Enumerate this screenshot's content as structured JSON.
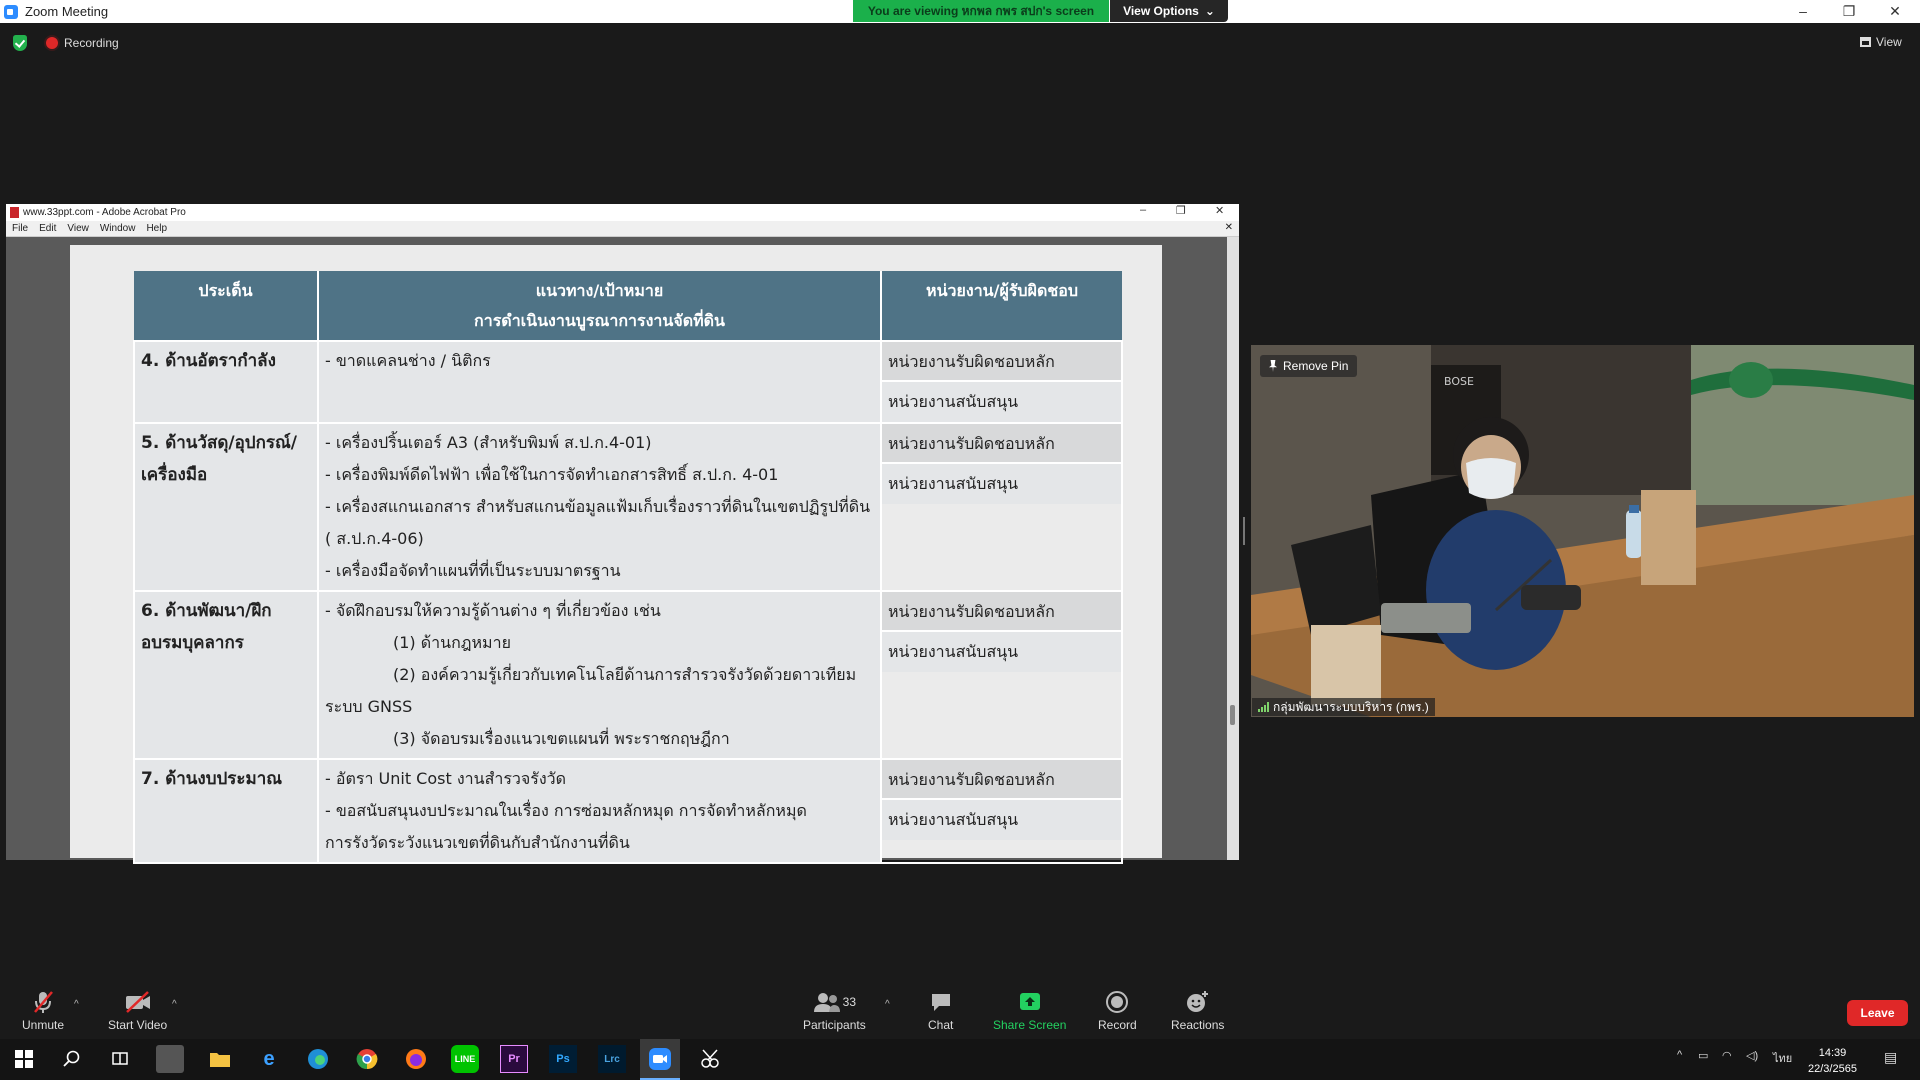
{
  "window": {
    "title": "Zoom Meeting",
    "banner": "You are viewing หกพล กพร สปก's screen",
    "view_options": "View Options",
    "minimize": "–",
    "restore": "❐",
    "close": "✕"
  },
  "meeting_bar": {
    "recording": "Recording",
    "view": "View"
  },
  "acrobat": {
    "title": "www.33ppt.com - Adobe Acrobat Pro",
    "menu": [
      "File",
      "Edit",
      "View",
      "Window",
      "Help"
    ]
  },
  "slide_table": {
    "headers": {
      "issue": "ประเด็น",
      "guide_line1": "แนวทาง/เป้าหมาย",
      "guide_line2": "การดำเนินงานบูรณาการงานจัดที่ดิน",
      "unit": "หน่วยงาน/ผู้รับผิดชอบ"
    },
    "unit_main": "หน่วยงานรับผิดชอบหลัก",
    "unit_support": "หน่วยงานสนับสนุน",
    "rows": [
      {
        "issue": "4. ด้านอัตรากำลัง",
        "lines": [
          "- ขาดแคลนช่าง / นิติกร"
        ]
      },
      {
        "issue": "5. ด้านวัสดุ/อุปกรณ์/เครื่องมือ",
        "lines": [
          "- เครื่องปริ้นเตอร์ A3 (สำหรับพิมพ์ ส.ป.ก.4-01)",
          "- เครื่องพิมพ์ดีดไฟฟ้า เพื่อใช้ในการจัดทำเอกสารสิทธิ์ ส.ป.ก. 4-01",
          "- เครื่องสแกนเอกสาร สำหรับสแกนข้อมูลแฟ้มเก็บเรื่องราวที่ดินในเขตปฏิรูปที่ดิน ( ส.ป.ก.4-06)",
          "- เครื่องมือจัดทำแผนที่ที่เป็นระบบมาตรฐาน"
        ]
      },
      {
        "issue": "6. ด้านพัฒนา/ฝึกอบรมบุคลากร",
        "lines": [
          "- จัดฝึกอบรมให้ความรู้ด้านต่าง ๆ ที่เกี่ยวข้อง เช่น",
          "(1) ด้านกฎหมาย",
          "(2) องค์ความรู้เกี่ยวกับเทคโนโลยีด้านการสำรวจรังวัดด้วยดาวเทียม",
          "ระบบ GNSS",
          "(3) จัดอบรมเรื่องแนวเขตแผนที่ พระราชกฤษฎีกา"
        ]
      },
      {
        "issue": "7. ด้านงบประมาณ",
        "lines": [
          "- อัตรา Unit Cost งานสำรวจรังวัด",
          "- ขอสนับสนุนงบประมาณในเรื่อง การซ่อมหลักหมุด การจัดทำหลักหมุด",
          "การรังวัดระวังแนวเขตที่ดินกับสำนักงานที่ดิน"
        ]
      }
    ]
  },
  "video": {
    "remove_pin": "Remove Pin",
    "participant_name": "กลุ่มพัฒนาระบบบริหาร (กพร.)",
    "brand_text": "BOSE"
  },
  "toolbar": {
    "unmute": "Unmute",
    "start_video": "Start Video",
    "participants": "Participants",
    "participants_count": "33",
    "chat": "Chat",
    "share_screen": "Share Screen",
    "record": "Record",
    "reactions": "Reactions",
    "leave": "Leave",
    "caret": "^"
  },
  "taskbar": {
    "apps": [
      "Pr",
      "Ps",
      "Lrc"
    ],
    "lang": "ไทย",
    "time": "14:39",
    "date": "22/3/2565"
  },
  "colors": {
    "banner_green": "#1bb04b",
    "share_green": "#23d160",
    "leave_red": "#e02828",
    "table_header": "#4f7386"
  }
}
